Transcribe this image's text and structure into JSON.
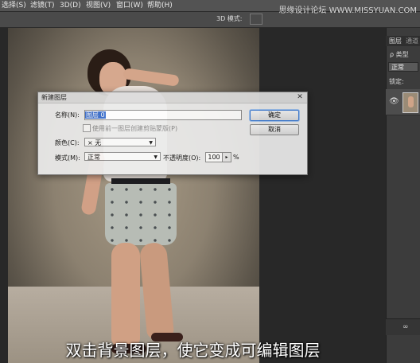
{
  "menubar": {
    "items": [
      "选择(S)",
      "滤镜(T)",
      "3D(D)",
      "视图(V)",
      "窗口(W)",
      "帮助(H)"
    ],
    "mode_label": "3D 模式:"
  },
  "watermark": "思缘设计论坛 WWW.MISSYUAN.COM",
  "dialog": {
    "title": "新建图层",
    "name_label": "名称(N):",
    "name_value": "图层 0",
    "clip_checkbox_label": "使用前一图层创建剪贴蒙版(P)",
    "color_label": "颜色(C):",
    "color_value": "无",
    "color_swatch": "×",
    "mode_label": "模式(M):",
    "mode_value": "正常",
    "opacity_label": "不透明度(O):",
    "opacity_value": "100",
    "opacity_unit": "%",
    "ok_label": "确定",
    "cancel_label": "取消"
  },
  "panel": {
    "tabs": [
      "图层",
      "通道"
    ],
    "filter_label": "ρ 类型",
    "blend_mode": "正常",
    "lock_label": "锁定:",
    "eye": "👁",
    "link_icon": "∞"
  },
  "subtitle": "双击背景图层，使它变成可编辑图层"
}
